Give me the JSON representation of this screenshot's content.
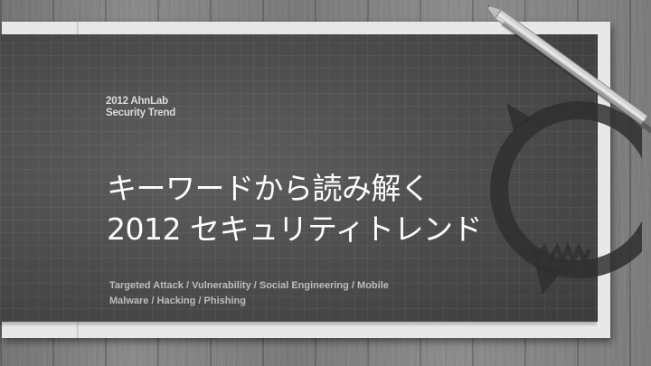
{
  "brand": {
    "line1": "2012 AhnLab",
    "line2": "Security Trend"
  },
  "title": {
    "line1": "キーワードから読み解く",
    "line2": "2012 セキュリティトレンド"
  },
  "keywords": {
    "line1": "Targeted Attack / Vulnerability / Social Engineering / Mobile",
    "line2": "Malware / Hacking / Phishing"
  },
  "colors": {
    "board": "#4b4b4b",
    "paper": "#e8e8e8",
    "title_text": "#ffffff",
    "keyword_text": "#bdbdbd"
  },
  "icons": [
    "ahnlab-emblem-icon",
    "pencil-icon"
  ]
}
